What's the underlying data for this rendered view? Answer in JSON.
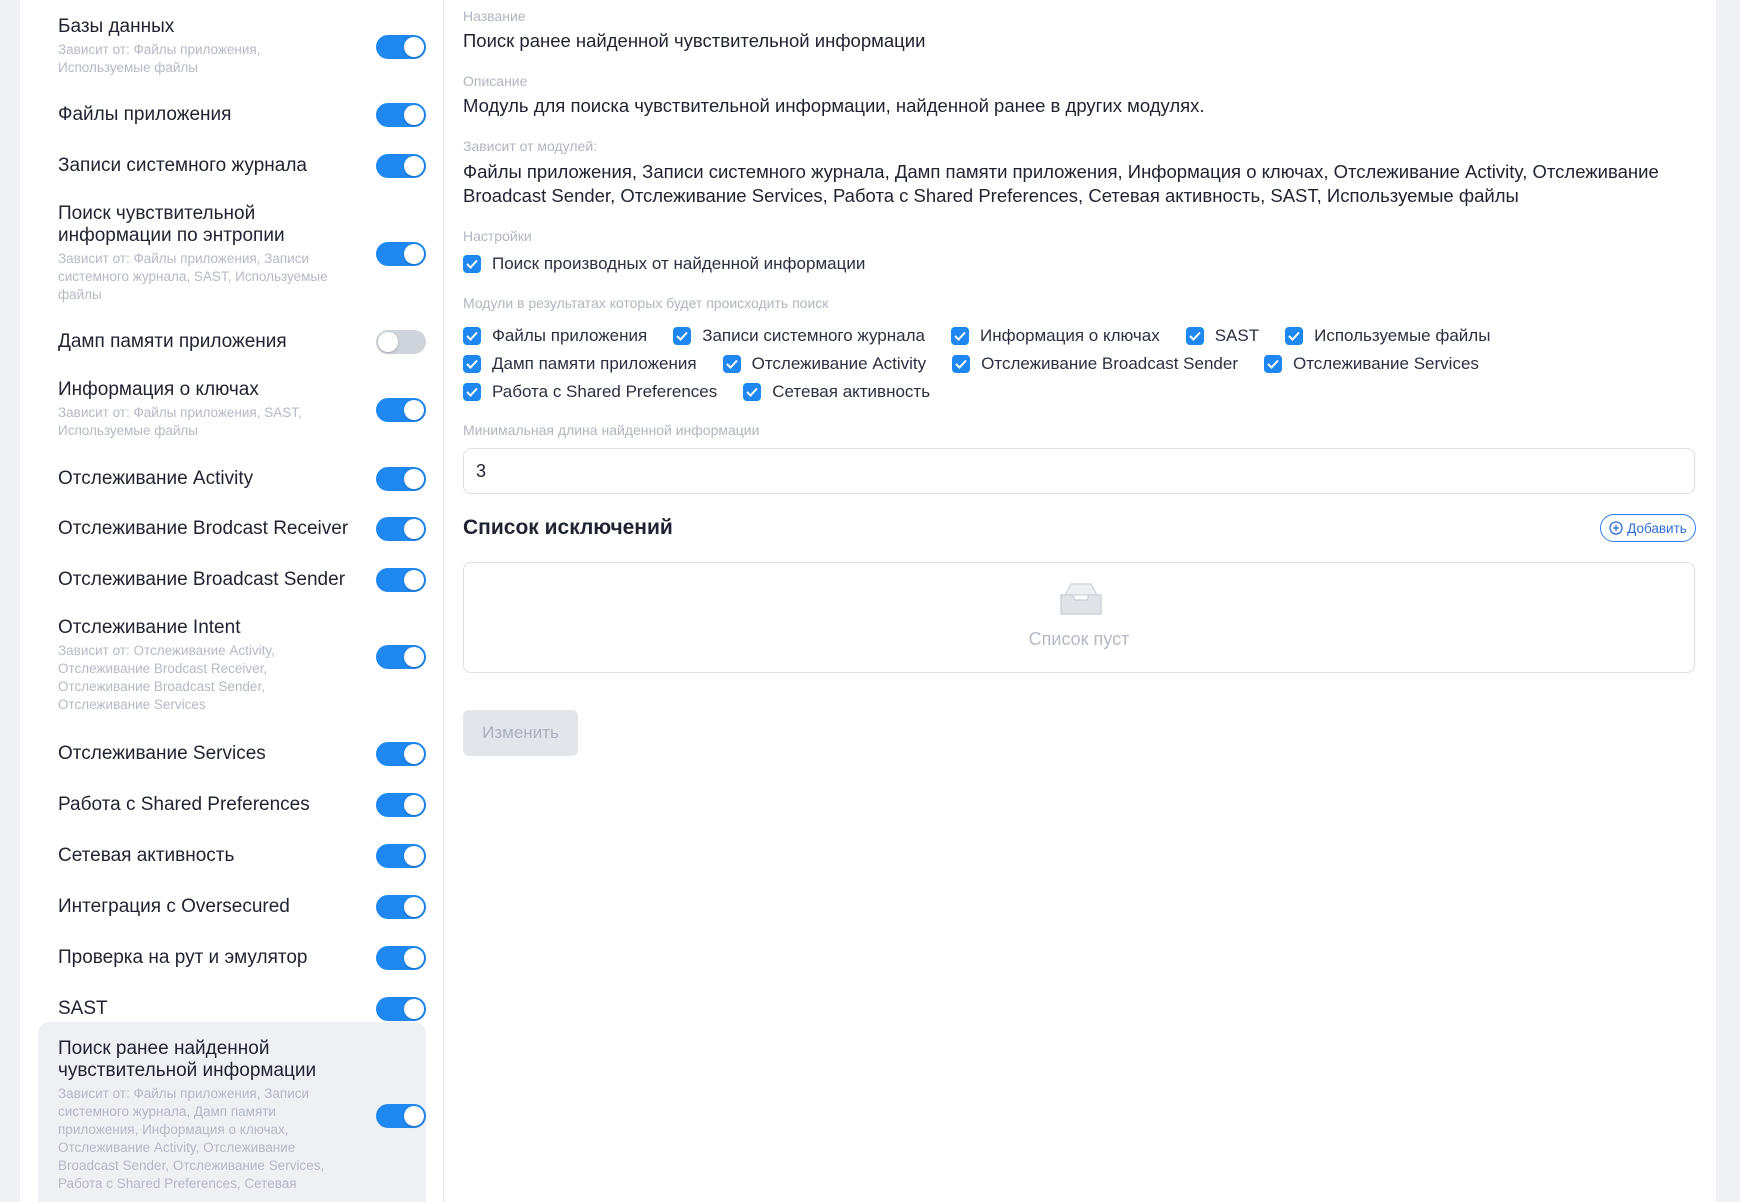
{
  "sidebar": {
    "items": [
      {
        "title": "Базы данных",
        "deps": "Зависит от:  Файлы приложения, Используемые файлы",
        "enabled": true
      },
      {
        "title": "Файлы приложения",
        "deps": "",
        "enabled": true
      },
      {
        "title": "Записи системного журнала",
        "deps": "",
        "enabled": true
      },
      {
        "title": "Поиск чувствительной информации по энтропии",
        "deps": "Зависит от:  Файлы приложения, Записи системного журнала, SAST, Используемые файлы",
        "enabled": true
      },
      {
        "title": "Дамп памяти приложения",
        "deps": "",
        "enabled": false
      },
      {
        "title": "Информация о ключах",
        "deps": "Зависит от:  Файлы приложения, SAST, Используемые файлы",
        "enabled": true
      },
      {
        "title": "Отслеживание Activity",
        "deps": "",
        "enabled": true
      },
      {
        "title": "Отслеживание Brodcast Receiver",
        "deps": "",
        "enabled": true
      },
      {
        "title": "Отслеживание Broadcast Sender",
        "deps": "",
        "enabled": true
      },
      {
        "title": "Отслеживание Intent",
        "deps": "Зависит от:  Отслеживание Activity, Отслеживание Brodcast Receiver, Отслеживание Broadcast Sender, Отслеживание Services",
        "enabled": true
      },
      {
        "title": "Отслеживание Services",
        "deps": "",
        "enabled": true
      },
      {
        "title": "Работа с Shared Preferences",
        "deps": "",
        "enabled": true
      },
      {
        "title": "Сетевая активность",
        "deps": "",
        "enabled": true
      },
      {
        "title": "Интеграция с Oversecured",
        "deps": "",
        "enabled": true
      },
      {
        "title": "Проверка на рут и эмулятор",
        "deps": "",
        "enabled": true
      },
      {
        "title": "SAST",
        "deps": "",
        "enabled": true
      },
      {
        "title": "Поиск ранее найденной чувствительной информации",
        "deps": "Зависит от:  Файлы приложения, Записи системного журнала, Дамп памяти приложения, Информация о ключах, Отслеживание Activity, Отслеживание Broadcast Sender, Отслеживание Services, Работа с Shared Preferences, Сетевая",
        "enabled": true,
        "selected": true
      }
    ]
  },
  "detail": {
    "name_label": "Название",
    "name_value": "Поиск ранее найденной чувствительной информации",
    "desc_label": "Описание",
    "desc_value": "Модуль для поиска чувствительной информации, найденной ранее в других модулях.",
    "deps_label": "Зависит от модулей:",
    "deps_value": "Файлы приложения, Записи системного журнала, Дамп памяти приложения, Информация о ключах, Отслеживание Activity, Отслеживание Broadcast Sender, Отслеживание Services, Работа с Shared Preferences, Сетевая активность, SAST, Используемые файлы",
    "settings_label": "Настройки",
    "settings_option": "Поиск производных от найденной информации",
    "modules_label": "Модули в результатах которых будет происходить поиск",
    "module_rows": [
      [
        "Файлы приложения",
        "Записи системного журнала",
        "Информация о ключах",
        "SAST",
        "Используемые файлы"
      ],
      [
        "Дамп памяти приложения",
        "Отслеживание Activity",
        "Отслеживание Broadcast Sender",
        "Отслеживание Services"
      ],
      [
        "Работа с Shared Preferences",
        "Сетевая активность"
      ]
    ],
    "min_len_label": "Минимальная длина найденной информации",
    "min_len_value": "3",
    "exclusions_title": "Список исключений",
    "add_label": "Добавить",
    "empty_text": "Список пуст",
    "edit_label": "Изменить"
  },
  "colors": {
    "accent": "#1e88f0",
    "toggle_off": "#cfd3da"
  }
}
